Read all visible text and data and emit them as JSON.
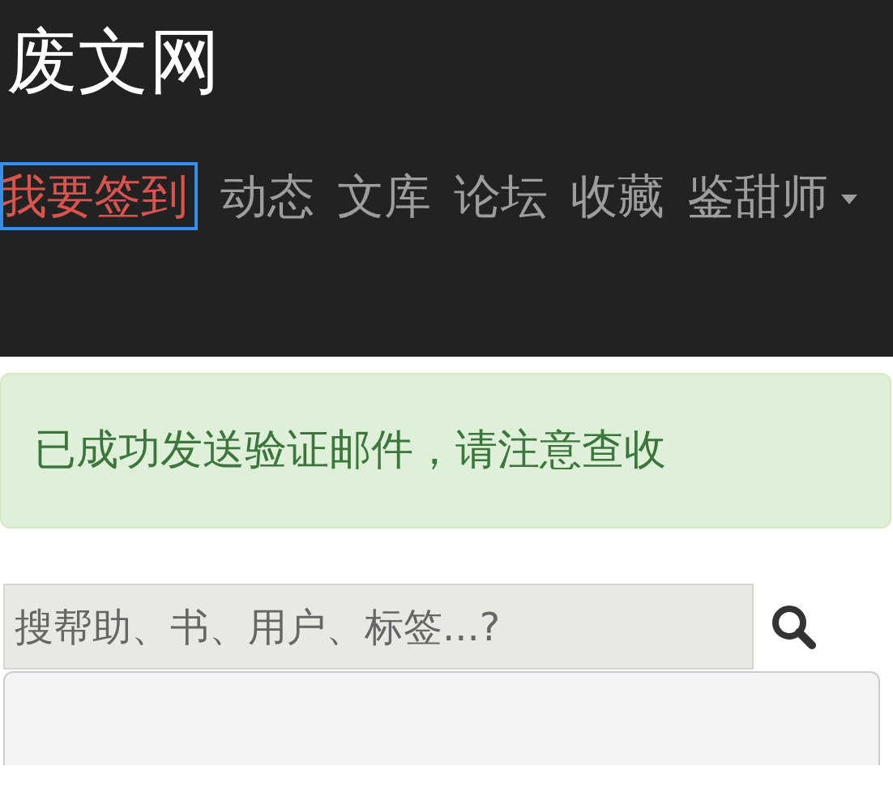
{
  "site_title": "废文网",
  "nav_items": [
    {
      "label": "我要签到",
      "kind": "highlight"
    },
    {
      "label": "动态",
      "kind": "link"
    },
    {
      "label": "文库",
      "kind": "link"
    },
    {
      "label": "论坛",
      "kind": "link"
    },
    {
      "label": "收藏",
      "kind": "link"
    },
    {
      "label": "鉴甜师",
      "kind": "dropdown"
    }
  ],
  "alert": {
    "text": "已成功发送验证邮件，请注意查收"
  },
  "search": {
    "placeholder": "搜帮助、书、用户、标签...?"
  }
}
